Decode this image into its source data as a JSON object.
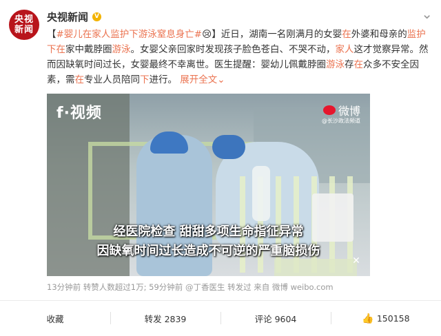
{
  "author": {
    "name": "央视新闻",
    "avatar_text": "央视新闻",
    "verified": true
  },
  "post": {
    "hashtag": "#婴儿在家人监护下游泳窒息身亡#",
    "emoji": "😢",
    "text_parts": [
      {
        "t": "】近日，湖南一名刚满月的女婴",
        "hl": false
      },
      {
        "t": "在",
        "hl": true
      },
      {
        "t": "外婆和母亲的",
        "hl": false
      },
      {
        "t": "监护下在",
        "hl": true
      },
      {
        "t": "家中戴脖圈",
        "hl": false
      },
      {
        "t": "游泳",
        "hl": true
      },
      {
        "t": "。女婴父亲回家时发现孩子脸色苍白、不哭不动，",
        "hl": false
      },
      {
        "t": "家人",
        "hl": true
      },
      {
        "t": "这才觉察异常。然而因缺氧时间过长，女婴最终不幸离世。医生提醒：婴幼儿佩戴脖圈",
        "hl": false
      },
      {
        "t": "游泳",
        "hl": true
      },
      {
        "t": "存",
        "hl": false
      },
      {
        "t": "在",
        "hl": true
      },
      {
        "t": "众多不安全因素，需",
        "hl": false
      },
      {
        "t": "在",
        "hl": true
      },
      {
        "t": "专业人员陪同",
        "hl": false
      },
      {
        "t": "下",
        "hl": true
      },
      {
        "t": "进行。",
        "hl": false
      }
    ],
    "expand_label": "展开全文",
    "expand_icon": "chevron-down-icon"
  },
  "video": {
    "brand": "f·视频",
    "watermark": "微博",
    "watermark_sub": "@长沙政法频道",
    "caption_line1": "经医院检查  甜甜多项生命指征异常",
    "caption_line2": "因缺氧时间过长造成不可逆的严重脑损伤"
  },
  "meta": {
    "time": "13分钟前",
    "reposts_note": "转赞人数超过1万;",
    "repost_time": "59分钟前",
    "repost_user": "@丁香医生",
    "repost_action": "转发过",
    "source_prefix": "来自",
    "source": "微博 weibo.com"
  },
  "actions": {
    "favorite": "收藏",
    "repost": "转发 2839",
    "comment": "评论 9604",
    "like": "150158"
  },
  "colors": {
    "highlight": "#eb7350",
    "verified": "#f3b300",
    "avatar": "#b8141b"
  }
}
